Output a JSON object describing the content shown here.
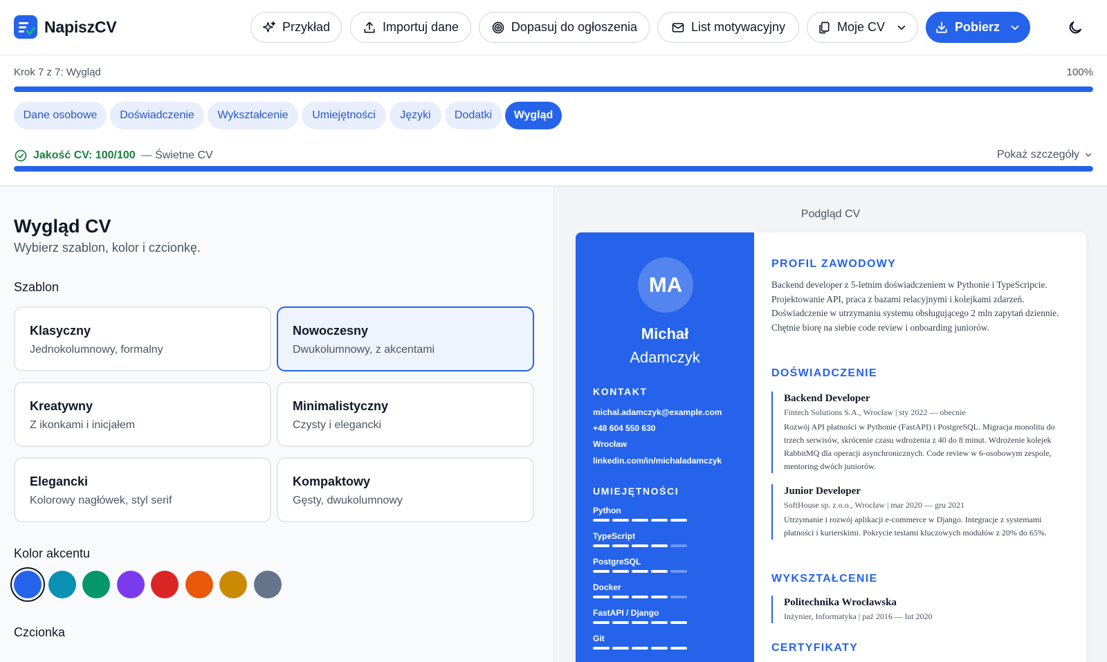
{
  "app": {
    "name": "NapiszCV"
  },
  "header": {
    "buttons": [
      {
        "label": "Przykład",
        "icon": "sparkles-icon"
      },
      {
        "label": "Importuj dane",
        "icon": "upload-icon"
      },
      {
        "label": "Dopasuj do ogłoszenia",
        "icon": "target-icon"
      },
      {
        "label": "List motywacyjny",
        "icon": "mail-icon"
      },
      {
        "label": "Moje CV",
        "icon": "copy-icon"
      },
      {
        "label": "Pobierz",
        "icon": "download-icon"
      }
    ]
  },
  "progress": {
    "step_label": "Krok 7 z 7: Wygląd",
    "percent_label": "100%",
    "fraction": 1.0
  },
  "tabs": [
    "Dane osobowe",
    "Doświadczenie",
    "Wykształcenie",
    "Umiejętności",
    "Języki",
    "Dodatki",
    "Wygląd"
  ],
  "active_tab": "Wygląd",
  "quality": {
    "score_label": "Jakość CV: 100/100",
    "verdict": "— Świetne CV",
    "details_label": "Pokaż szczegóły",
    "fraction": 1.0
  },
  "appearance": {
    "title": "Wygląd CV",
    "subtitle": "Wybierz szablon, kolor i czcionkę.",
    "template_label": "Szablon",
    "templates": [
      {
        "name": "Klasyczny",
        "desc": "Jednokolumnowy, formalny"
      },
      {
        "name": "Nowoczesny",
        "desc": "Dwukolumnowy, z akcentami"
      },
      {
        "name": "Kreatywny",
        "desc": "Z ikonkami i inicjałem"
      },
      {
        "name": "Minimalistyczny",
        "desc": "Czysty i elegancki"
      },
      {
        "name": "Elegancki",
        "desc": "Kolorowy nagłówek, styl serif"
      },
      {
        "name": "Kompaktowy",
        "desc": "Gęsty, dwukolumnowy"
      }
    ],
    "selected_template": "Nowoczesny",
    "accent_label": "Kolor akcentu",
    "accent_colors": [
      "#2563eb",
      "#0891b2",
      "#059669",
      "#7c3aed",
      "#dc2626",
      "#ea580c",
      "#ca8a04",
      "#64748b"
    ],
    "selected_accent": "#2563eb",
    "font_label": "Czcionka"
  },
  "preview": {
    "label": "Podgląd CV",
    "initials": "MA",
    "first_name": "Michał",
    "last_name": "Adamczyk",
    "contact_heading": "KONTAKT",
    "contact": [
      "michal.adamczyk@example.com",
      "+48 604 550 630",
      "Wrocław",
      "linkedin.com/in/michaladamczyk"
    ],
    "skills_heading": "UMIEJĘTNOŚCI",
    "skills": [
      {
        "name": "Python",
        "level": 5
      },
      {
        "name": "TypeScript",
        "level": 4
      },
      {
        "name": "PostgreSQL",
        "level": 4
      },
      {
        "name": "Docker",
        "level": 4
      },
      {
        "name": "FastAPI / Django",
        "level": 5
      },
      {
        "name": "Git",
        "level": 5
      }
    ],
    "skill_max": 5,
    "profile_heading": "PROFIL ZAWODOWY",
    "profile": "Backend developer z 5-letnim doświadczeniem w Pythonie i TypeScripcie. Projektowanie API, praca z bazami relacyjnymi i kolejkami zdarzeń. Doświadczenie w utrzymaniu systemu obsługującego 2 mln zapytań dziennie. Chętnie biorę na siebie code review i onboarding juniorów.",
    "experience_heading": "DOŚWIADCZENIE",
    "experience": [
      {
        "title": "Backend Developer",
        "meta": "Fintech Solutions S.A., Wrocław | sty 2022 — obecnie",
        "desc": "Rozwój API płatności w Pythonie (FastAPI) i PostgreSQL. Migracja monolitu do trzech serwisów, skrócenie czasu wdrożenia z 40 do 8 minut. Wdrożenie kolejek RabbitMQ dla operacji asynchronicznych. Code review w 6-osobowym zespole, mentoring dwóch juniorów."
      },
      {
        "title": "Junior Developer",
        "meta": "SoftHouse sp. z o.o., Wrocław | mar 2020 — gru 2021",
        "desc": "Utrzymanie i rozwój aplikacji e-commerce w Django. Integracje z systemami płatności i kurierskimi. Pokrycie testami kluczowych modułów z 20% do 65%."
      }
    ],
    "education_heading": "WYKSZTAŁCENIE",
    "education": [
      {
        "title": "Politechnika Wrocławska",
        "meta": "Inżynier, Informatyka | paź 2016 — lut 2020"
      }
    ],
    "certs_heading": "CERTYFIKATY"
  }
}
